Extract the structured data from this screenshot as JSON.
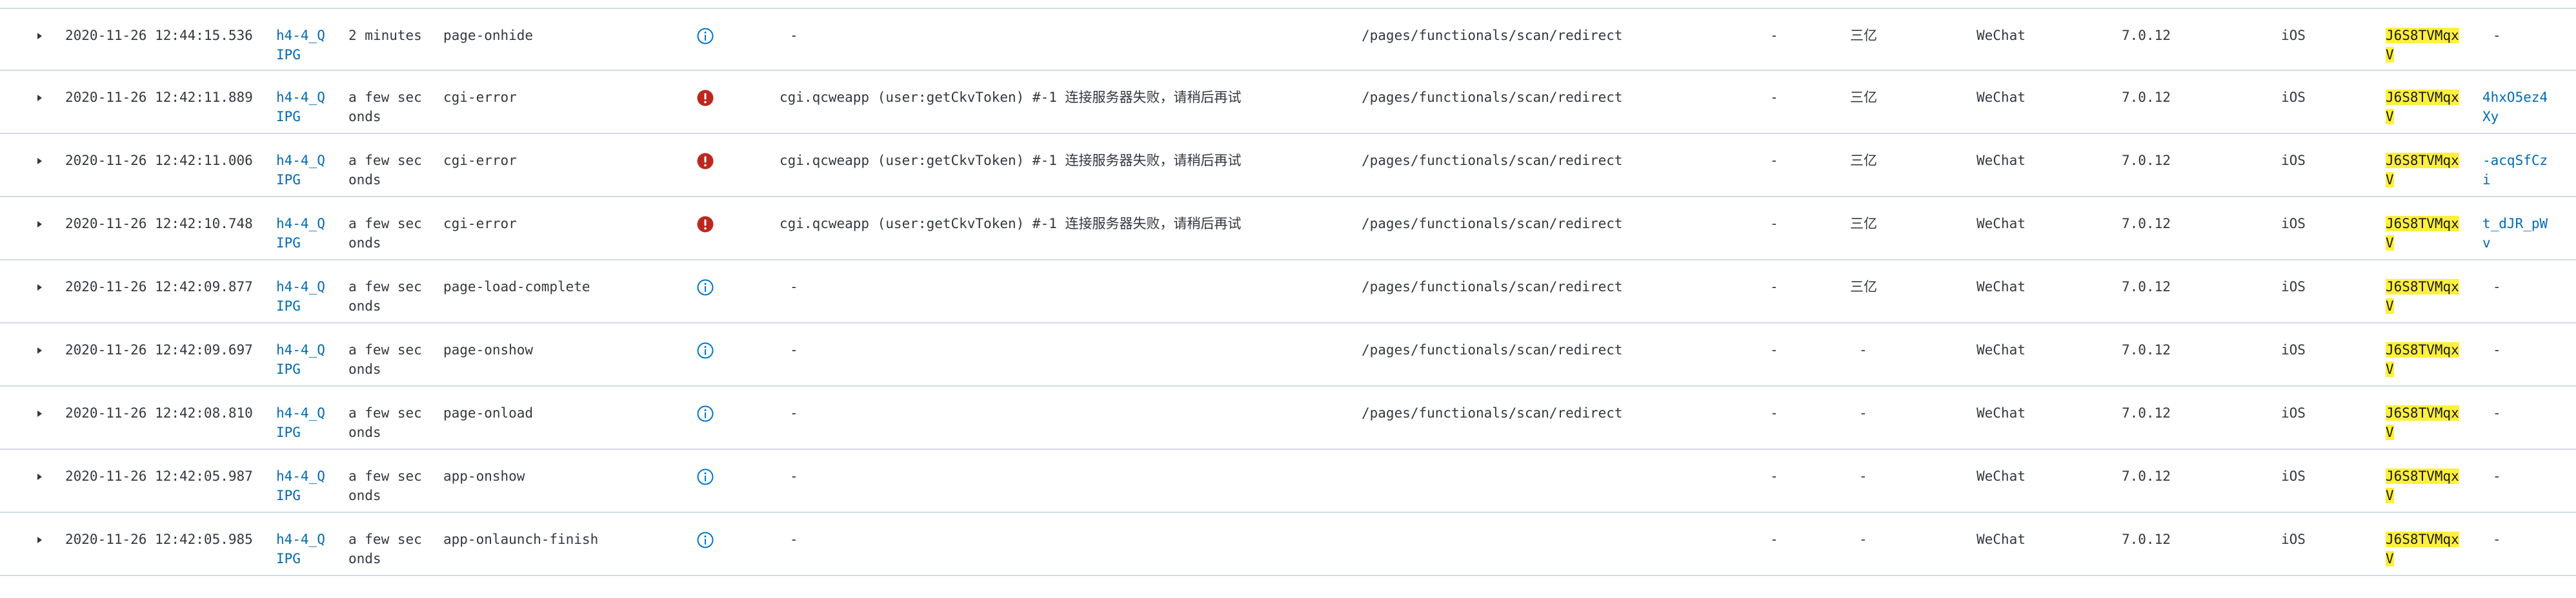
{
  "colors": {
    "link": "#006bb4",
    "error": "#bd271e",
    "info": "#0077cc",
    "highlight": "#fff03b",
    "border": "#d3dae6"
  },
  "rows": [
    {
      "timestamp": "2020-11-26 12:44:15.536",
      "session": [
        "h4-4_Q",
        "IPG"
      ],
      "age": [
        "2 minutes",
        ""
      ],
      "event": "page-onhide",
      "level_icon": "info-icon",
      "message": "-",
      "path": "/pages/functionals/scan/redirect",
      "col_a": "-",
      "col_b": "三亿",
      "app": "WeChat",
      "version": "7.0.12",
      "os": "iOS",
      "user": [
        "J6S8TVMqx",
        "V"
      ],
      "id": [
        "-",
        ""
      ],
      "id_is_link": false
    },
    {
      "timestamp": "2020-11-26 12:42:11.889",
      "session": [
        "h4-4_Q",
        "IPG"
      ],
      "age": [
        "a few sec",
        "onds"
      ],
      "event": "cgi-error",
      "level_icon": "error-icon",
      "message": "cgi.qcweapp (user:getCkvToken) #-1 连接服务器失败，请稍后再试",
      "path": "/pages/functionals/scan/redirect",
      "col_a": "-",
      "col_b": "三亿",
      "app": "WeChat",
      "version": "7.0.12",
      "os": "iOS",
      "user": [
        "J6S8TVMqx",
        "V"
      ],
      "id": [
        "4hxO5ez4",
        "Xy"
      ],
      "id_is_link": true
    },
    {
      "timestamp": "2020-11-26 12:42:11.006",
      "session": [
        "h4-4_Q",
        "IPG"
      ],
      "age": [
        "a few sec",
        "onds"
      ],
      "event": "cgi-error",
      "level_icon": "error-icon",
      "message": "cgi.qcweapp (user:getCkvToken) #-1 连接服务器失败，请稍后再试",
      "path": "/pages/functionals/scan/redirect",
      "col_a": "-",
      "col_b": "三亿",
      "app": "WeChat",
      "version": "7.0.12",
      "os": "iOS",
      "user": [
        "J6S8TVMqx",
        "V"
      ],
      "id": [
        "-acqSfCz",
        "i"
      ],
      "id_is_link": true
    },
    {
      "timestamp": "2020-11-26 12:42:10.748",
      "session": [
        "h4-4_Q",
        "IPG"
      ],
      "age": [
        "a few sec",
        "onds"
      ],
      "event": "cgi-error",
      "level_icon": "error-icon",
      "message": "cgi.qcweapp (user:getCkvToken) #-1 连接服务器失败，请稍后再试",
      "path": "/pages/functionals/scan/redirect",
      "col_a": "-",
      "col_b": "三亿",
      "app": "WeChat",
      "version": "7.0.12",
      "os": "iOS",
      "user": [
        "J6S8TVMqx",
        "V"
      ],
      "id": [
        "t_dJR_pW",
        "v"
      ],
      "id_is_link": true
    },
    {
      "timestamp": "2020-11-26 12:42:09.877",
      "session": [
        "h4-4_Q",
        "IPG"
      ],
      "age": [
        "a few sec",
        "onds"
      ],
      "event": "page-load-complete",
      "level_icon": "info-icon",
      "message": "-",
      "path": "/pages/functionals/scan/redirect",
      "col_a": "-",
      "col_b": "三亿",
      "app": "WeChat",
      "version": "7.0.12",
      "os": "iOS",
      "user": [
        "J6S8TVMqx",
        "V"
      ],
      "id": [
        "-",
        ""
      ],
      "id_is_link": false
    },
    {
      "timestamp": "2020-11-26 12:42:09.697",
      "session": [
        "h4-4_Q",
        "IPG"
      ],
      "age": [
        "a few sec",
        "onds"
      ],
      "event": "page-onshow",
      "level_icon": "info-icon",
      "message": "-",
      "path": "/pages/functionals/scan/redirect",
      "col_a": "-",
      "col_b": "-",
      "app": "WeChat",
      "version": "7.0.12",
      "os": "iOS",
      "user": [
        "J6S8TVMqx",
        "V"
      ],
      "id": [
        "-",
        ""
      ],
      "id_is_link": false
    },
    {
      "timestamp": "2020-11-26 12:42:08.810",
      "session": [
        "h4-4_Q",
        "IPG"
      ],
      "age": [
        "a few sec",
        "onds"
      ],
      "event": "page-onload",
      "level_icon": "info-icon",
      "message": "-",
      "path": "/pages/functionals/scan/redirect",
      "col_a": "-",
      "col_b": "-",
      "app": "WeChat",
      "version": "7.0.12",
      "os": "iOS",
      "user": [
        "J6S8TVMqx",
        "V"
      ],
      "id": [
        "-",
        ""
      ],
      "id_is_link": false
    },
    {
      "timestamp": "2020-11-26 12:42:05.987",
      "session": [
        "h4-4_Q",
        "IPG"
      ],
      "age": [
        "a few sec",
        "onds"
      ],
      "event": "app-onshow",
      "level_icon": "info-icon",
      "message": "-",
      "path": "",
      "col_a": "-",
      "col_b": "-",
      "app": "WeChat",
      "version": "7.0.12",
      "os": "iOS",
      "user": [
        "J6S8TVMqx",
        "V"
      ],
      "id": [
        "-",
        ""
      ],
      "id_is_link": false
    },
    {
      "timestamp": "2020-11-26 12:42:05.985",
      "session": [
        "h4-4_Q",
        "IPG"
      ],
      "age": [
        "a few sec",
        "onds"
      ],
      "event": "app-onlaunch-finish",
      "level_icon": "info-icon",
      "message": "-",
      "path": "",
      "col_a": "-",
      "col_b": "-",
      "app": "WeChat",
      "version": "7.0.12",
      "os": "iOS",
      "user": [
        "J6S8TVMqx",
        "V"
      ],
      "id": [
        "-",
        ""
      ],
      "id_is_link": false
    }
  ]
}
